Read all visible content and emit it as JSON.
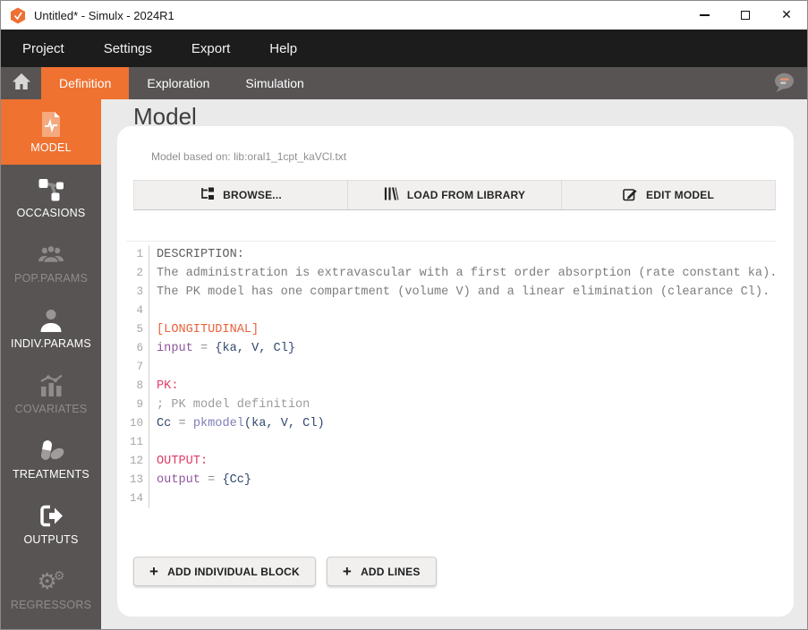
{
  "window": {
    "title": "Untitled* - Simulx - 2024R1",
    "controls": [
      {
        "name": "minimize"
      },
      {
        "name": "maximize"
      },
      {
        "name": "close"
      }
    ]
  },
  "menu": {
    "items": [
      "Project",
      "Settings",
      "Export",
      "Help"
    ]
  },
  "tabs": {
    "items": [
      {
        "label": "Definition",
        "active": true
      },
      {
        "label": "Exploration",
        "active": false
      },
      {
        "label": "Simulation",
        "active": false
      }
    ]
  },
  "sidebar": {
    "items": [
      {
        "label": "MODEL",
        "icon": "model-icon",
        "state": "active"
      },
      {
        "label": "OCCASIONS",
        "icon": "occasions-icon",
        "state": "enabled"
      },
      {
        "label": "POP.PARAMS",
        "icon": "pop-params-icon",
        "state": "disabled"
      },
      {
        "label": "INDIV.PARAMS",
        "icon": "indiv-params-icon",
        "state": "enabled"
      },
      {
        "label": "COVARIATES",
        "icon": "covariates-icon",
        "state": "disabled"
      },
      {
        "label": "TREATMENTS",
        "icon": "treatments-icon",
        "state": "enabled"
      },
      {
        "label": "OUTPUTS",
        "icon": "outputs-icon",
        "state": "enabled"
      },
      {
        "label": "REGRESSORS",
        "icon": "regressors-icon",
        "state": "disabled"
      }
    ]
  },
  "main": {
    "title": "Model",
    "subtitle": "Model based on: lib:oral1_1cpt_kaVCl.txt",
    "toolbar": [
      {
        "label": "BROWSE...",
        "icon": "browse-icon"
      },
      {
        "label": "LOAD FROM LIBRARY",
        "icon": "library-icon"
      },
      {
        "label": "EDIT MODEL",
        "icon": "edit-icon"
      }
    ],
    "editor": {
      "lines": [
        {
          "n": 1,
          "tokens": [
            {
              "text": "DESCRIPTION:",
              "color": "heading"
            }
          ]
        },
        {
          "n": 2,
          "tokens": [
            {
              "text": "The administration is extravascular with a first order absorption (rate constant ka).",
              "color": "text"
            }
          ]
        },
        {
          "n": 3,
          "tokens": [
            {
              "text": "The PK model has one compartment (volume V) and a linear elimination (clearance Cl).",
              "color": "text"
            }
          ]
        },
        {
          "n": 4,
          "tokens": []
        },
        {
          "n": 5,
          "tokens": [
            {
              "text": "[LONGITUDINAL]",
              "color": "section"
            }
          ]
        },
        {
          "n": 6,
          "tokens": [
            {
              "text": "input",
              "color": "keyword"
            },
            {
              "text": " = ",
              "color": "operator"
            },
            {
              "text": "{ka, V, Cl}",
              "color": "var"
            }
          ]
        },
        {
          "n": 7,
          "tokens": []
        },
        {
          "n": 8,
          "tokens": [
            {
              "text": "PK:",
              "color": "label"
            }
          ]
        },
        {
          "n": 9,
          "tokens": [
            {
              "text": "; PK model definition",
              "color": "comment"
            }
          ]
        },
        {
          "n": 10,
          "tokens": [
            {
              "text": "Cc",
              "color": "var"
            },
            {
              "text": " = ",
              "color": "operator"
            },
            {
              "text": "pkmodel",
              "color": "func"
            },
            {
              "text": "(ka, V, Cl)",
              "color": "var"
            }
          ]
        },
        {
          "n": 11,
          "tokens": []
        },
        {
          "n": 12,
          "tokens": [
            {
              "text": "OUTPUT:",
              "color": "label"
            }
          ]
        },
        {
          "n": 13,
          "tokens": [
            {
              "text": "output",
              "color": "keyword"
            },
            {
              "text": " = ",
              "color": "operator"
            },
            {
              "text": "{Cc}",
              "color": "var"
            }
          ]
        },
        {
          "n": 14,
          "tokens": []
        }
      ]
    },
    "actions": [
      {
        "label": "ADD INDIVIDUAL BLOCK",
        "icon": "plus-icon"
      },
      {
        "label": "ADD LINES",
        "icon": "plus-icon"
      }
    ]
  },
  "colors": {
    "accent": "#ef7231",
    "menubar_bg": "#1d1c1c",
    "sidebar_bg": "#585454",
    "main_bg": "#ebeaea",
    "tok_heading": "#5f5f5f",
    "tok_text": "#7d7d7d",
    "tok_section": "#e8633c",
    "tok_keyword": "#8d569b",
    "tok_operator": "#8f8f8f",
    "tok_var": "#32486e",
    "tok_label": "#e13b68",
    "tok_comment": "#9c9c9c",
    "tok_func": "#7f7fb8"
  }
}
